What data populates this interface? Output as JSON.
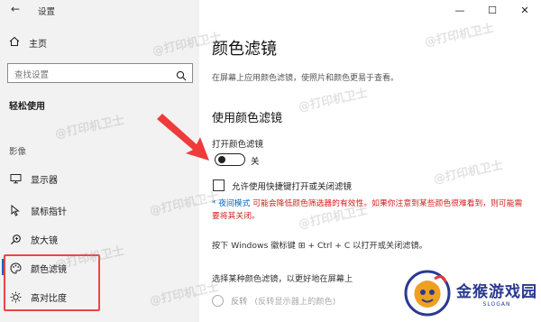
{
  "window": {
    "title": "设置",
    "back": "←",
    "minimize": "—",
    "maximize": "☐",
    "close": "✕"
  },
  "sidebar": {
    "home_label": "主页",
    "search_placeholder": "查找设置",
    "section_heading": "轻松使用",
    "group_label": "影像",
    "items": [
      {
        "label": "显示器",
        "icon": "display-icon"
      },
      {
        "label": "鼠标指针",
        "icon": "mouse-pointer-icon"
      },
      {
        "label": "放大镜",
        "icon": "magnifier-icon"
      },
      {
        "label": "颜色滤镜",
        "icon": "palette-icon",
        "active": true
      },
      {
        "label": "高对比度",
        "icon": "sun-icon"
      }
    ]
  },
  "main": {
    "title": "颜色滤镜",
    "description": "在屏幕上应用颜色滤镜，使照片和颜色更易于查看。",
    "sub_title": "使用颜色滤镜",
    "toggle_label": "打开颜色滤镜",
    "toggle_state": "关",
    "toggle_on": false,
    "shortcut_checkbox_label": "允许使用快捷键打开或关闭滤镜",
    "shortcut_checked": false,
    "warning_link": "* 夜间模式",
    "warning_text": "可能会降低颜色筛选器的有效性。如果你注意到某些颜色很难看到，则可能需要将其关闭。",
    "hint": "按下 Windows 徽标键 ⊞ + Ctrl + C 以打开或关闭滤镜。",
    "select_text": "选择某种颜色滤镜，以更好地在屏幕上",
    "radio_label": "反转",
    "radio_hint": "(反转显示器上的颜色)"
  },
  "overlays": {
    "watermark": "@打印机卫士",
    "logo_text": "金猴游戏园",
    "logo_sub": "SLOGAN",
    "highlight_color": "#ef4444",
    "arrow_color": "#ef3b3b"
  },
  "colors": {
    "accent": "#0067c0",
    "warning": "#d21f1f",
    "sidebar_bg": "#f2f2f2"
  }
}
